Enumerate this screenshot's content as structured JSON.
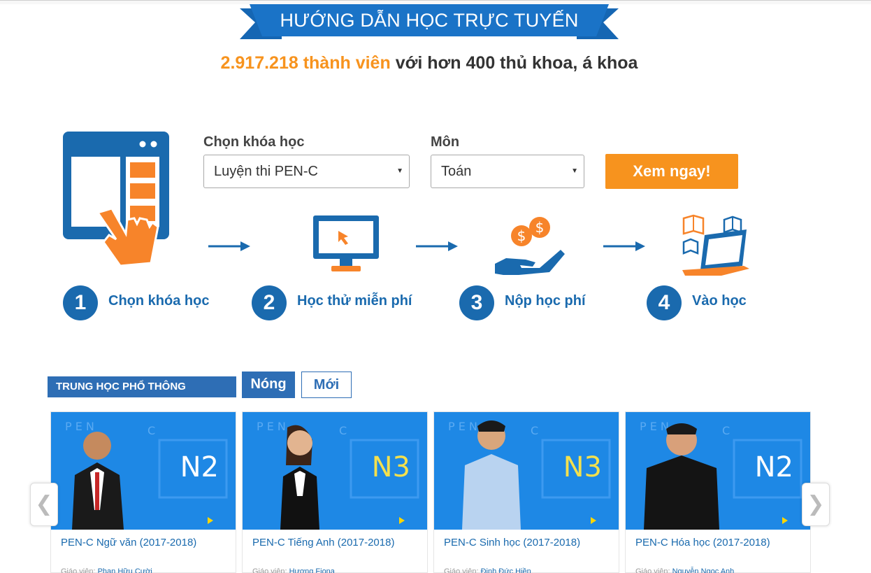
{
  "banner": {
    "title": "HƯỚNG DẪN HỌC TRỰC TUYẾN"
  },
  "stats": {
    "members": "2.917.218 thành viên",
    "rest": "với hơn 400 thủ khoa, á khoa"
  },
  "form": {
    "course_label": "Chọn khóa học",
    "course_value": "Luyện thi PEN-C",
    "subject_label": "Môn",
    "subject_value": "Toán",
    "submit_label": "Xem ngay!"
  },
  "steps": [
    {
      "num": "1",
      "label": "Chọn khóa học",
      "icon": "tablet-hand-icon"
    },
    {
      "num": "2",
      "label": "Học thử miễn phí",
      "icon": "monitor-cursor-icon"
    },
    {
      "num": "3",
      "label": "Nộp học phí",
      "icon": "hand-coins-icon"
    },
    {
      "num": "4",
      "label": "Vào học",
      "icon": "laptop-books-icon"
    }
  ],
  "section": {
    "category": "TRUNG HỌC PHỔ THÔNG",
    "tabs": [
      "Nóng",
      "Mới"
    ]
  },
  "courses": [
    {
      "title": "PEN-C Ngữ văn (2017-2018)",
      "code": "N2",
      "teacher_prefix": "Giáo viên:",
      "teacher": "Phan Hữu Cười"
    },
    {
      "title": "PEN-C Tiếng Anh (2017-2018)",
      "code": "N3",
      "teacher_prefix": "Giáo viên:",
      "teacher": "Hương Fiona"
    },
    {
      "title": "PEN-C Sinh học (2017-2018)",
      "code": "N3",
      "teacher_prefix": "Giáo viên:",
      "teacher": "Đinh Đức Hiền"
    },
    {
      "title": "PEN-C Hóa học (2017-2018)",
      "code": "N2",
      "teacher_prefix": "Giáo viên:",
      "teacher": "Nguyễn Ngọc Anh"
    }
  ],
  "carousel": {
    "prev": "❮",
    "next": "❯"
  },
  "colors": {
    "brand_blue": "#1a6aae",
    "accent_orange": "#f7931e",
    "tab_blue": "#2e6eb5",
    "thumb_blue": "#1e88e5"
  }
}
